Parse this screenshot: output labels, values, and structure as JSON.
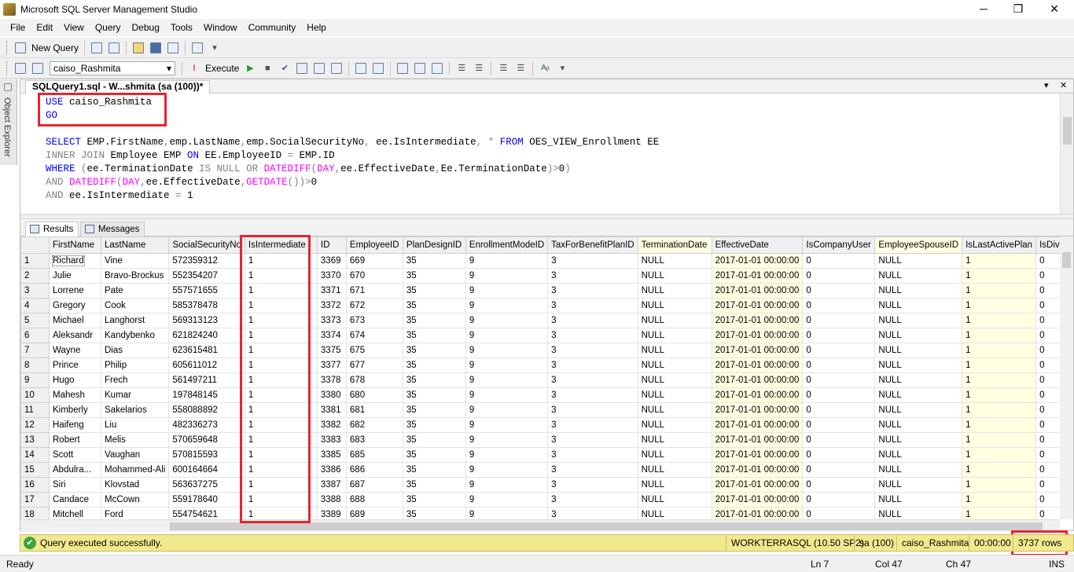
{
  "window": {
    "title": "Microsoft SQL Server Management Studio",
    "min": "─",
    "max": "❐",
    "close": "✕"
  },
  "menu": [
    "File",
    "Edit",
    "View",
    "Query",
    "Debug",
    "Tools",
    "Window",
    "Community",
    "Help"
  ],
  "toolbar1": {
    "new_query": "New Query"
  },
  "toolbar2": {
    "database": "caiso_Rashmita",
    "execute": "Execute"
  },
  "object_explorer": "Object Explorer",
  "tab": {
    "title": "SQLQuery1.sql - W...shmita (sa (100))*"
  },
  "result_tabs": [
    "Results",
    "Messages"
  ],
  "grid": {
    "columns": [
      "FirstName",
      "LastName",
      "SocialSecurityNo",
      "IsIntermediate",
      "ID",
      "EmployeeID",
      "PlanDesignID",
      "EnrollmentModeID",
      "TaxForBenefitPlanID",
      "TerminationDate",
      "EffectiveDate",
      "IsCompanyUser",
      "EmployeeSpouseID",
      "IsLastActivePlan",
      "IsDivc"
    ],
    "rows": [
      [
        "1",
        "Richard",
        "Vine",
        "572359312",
        "1",
        "3369",
        "669",
        "35",
        "9",
        "3",
        "NULL",
        "2017-01-01 00:00:00",
        "0",
        "NULL",
        "1",
        "0"
      ],
      [
        "2",
        "Julie",
        "Bravo-Brockus",
        "552354207",
        "1",
        "3370",
        "670",
        "35",
        "9",
        "3",
        "NULL",
        "2017-01-01 00:00:00",
        "0",
        "NULL",
        "1",
        "0"
      ],
      [
        "3",
        "Lorrene",
        "Pate",
        "557571655",
        "1",
        "3371",
        "671",
        "35",
        "9",
        "3",
        "NULL",
        "2017-01-01 00:00:00",
        "0",
        "NULL",
        "1",
        "0"
      ],
      [
        "4",
        "Gregory",
        "Cook",
        "585378478",
        "1",
        "3372",
        "672",
        "35",
        "9",
        "3",
        "NULL",
        "2017-01-01 00:00:00",
        "0",
        "NULL",
        "1",
        "0"
      ],
      [
        "5",
        "Michael",
        "Langhorst",
        "569313123",
        "1",
        "3373",
        "673",
        "35",
        "9",
        "3",
        "NULL",
        "2017-01-01 00:00:00",
        "0",
        "NULL",
        "1",
        "0"
      ],
      [
        "6",
        "Aleksandr",
        "Kandybenko",
        "621824240",
        "1",
        "3374",
        "674",
        "35",
        "9",
        "3",
        "NULL",
        "2017-01-01 00:00:00",
        "0",
        "NULL",
        "1",
        "0"
      ],
      [
        "7",
        "Wayne",
        "Dias",
        "623615481",
        "1",
        "3375",
        "675",
        "35",
        "9",
        "3",
        "NULL",
        "2017-01-01 00:00:00",
        "0",
        "NULL",
        "1",
        "0"
      ],
      [
        "8",
        "Prince",
        "Philip",
        "605611012",
        "1",
        "3377",
        "677",
        "35",
        "9",
        "3",
        "NULL",
        "2017-01-01 00:00:00",
        "0",
        "NULL",
        "1",
        "0"
      ],
      [
        "9",
        "Hugo",
        "Frech",
        "561497211",
        "1",
        "3378",
        "678",
        "35",
        "9",
        "3",
        "NULL",
        "2017-01-01 00:00:00",
        "0",
        "NULL",
        "1",
        "0"
      ],
      [
        "10",
        "Mahesh",
        "Kumar",
        "197848145",
        "1",
        "3380",
        "680",
        "35",
        "9",
        "3",
        "NULL",
        "2017-01-01 00:00:00",
        "0",
        "NULL",
        "1",
        "0"
      ],
      [
        "11",
        "Kimberly",
        "Sakelarios",
        "558088892",
        "1",
        "3381",
        "681",
        "35",
        "9",
        "3",
        "NULL",
        "2017-01-01 00:00:00",
        "0",
        "NULL",
        "1",
        "0"
      ],
      [
        "12",
        "Haifeng",
        "Liu",
        "482336273",
        "1",
        "3382",
        "682",
        "35",
        "9",
        "3",
        "NULL",
        "2017-01-01 00:00:00",
        "0",
        "NULL",
        "1",
        "0"
      ],
      [
        "13",
        "Robert",
        "Melis",
        "570659648",
        "1",
        "3383",
        "683",
        "35",
        "9",
        "3",
        "NULL",
        "2017-01-01 00:00:00",
        "0",
        "NULL",
        "1",
        "0"
      ],
      [
        "14",
        "Scott",
        "Vaughan",
        "570815593",
        "1",
        "3385",
        "685",
        "35",
        "9",
        "3",
        "NULL",
        "2017-01-01 00:00:00",
        "0",
        "NULL",
        "1",
        "0"
      ],
      [
        "15",
        "Abdulra...",
        "Mohammed-Ali",
        "600164664",
        "1",
        "3386",
        "686",
        "35",
        "9",
        "3",
        "NULL",
        "2017-01-01 00:00:00",
        "0",
        "NULL",
        "1",
        "0"
      ],
      [
        "16",
        "Siri",
        "Klovstad",
        "563637275",
        "1",
        "3387",
        "687",
        "35",
        "9",
        "3",
        "NULL",
        "2017-01-01 00:00:00",
        "0",
        "NULL",
        "1",
        "0"
      ],
      [
        "17",
        "Candace",
        "McCown",
        "559178640",
        "1",
        "3388",
        "688",
        "35",
        "9",
        "3",
        "NULL",
        "2017-01-01 00:00:00",
        "0",
        "NULL",
        "1",
        "0"
      ],
      [
        "18",
        "Mitchell",
        "Ford",
        "554754621",
        "1",
        "3389",
        "689",
        "35",
        "9",
        "3",
        "NULL",
        "2017-01-01 00:00:00",
        "0",
        "NULL",
        "1",
        "0"
      ]
    ]
  },
  "query_status": {
    "message": "Query executed successfully.",
    "server": "WORKTERRASQL (10.50 SP2)",
    "user": "sa (100)",
    "database": "caiso_Rashmita",
    "elapsed": "00:00:00",
    "rows": "3737 rows"
  },
  "status": {
    "ready": "Ready",
    "ln": "Ln 7",
    "col": "Col 47",
    "ch": "Ch 47",
    "ins": "INS"
  },
  "colors": {
    "highlight": "#e3262e",
    "null_cell": "#ffffe1",
    "status_bg": "#f2e98f",
    "keyword": "#0000ff",
    "function": "#ff00ff",
    "operator": "#808080"
  }
}
